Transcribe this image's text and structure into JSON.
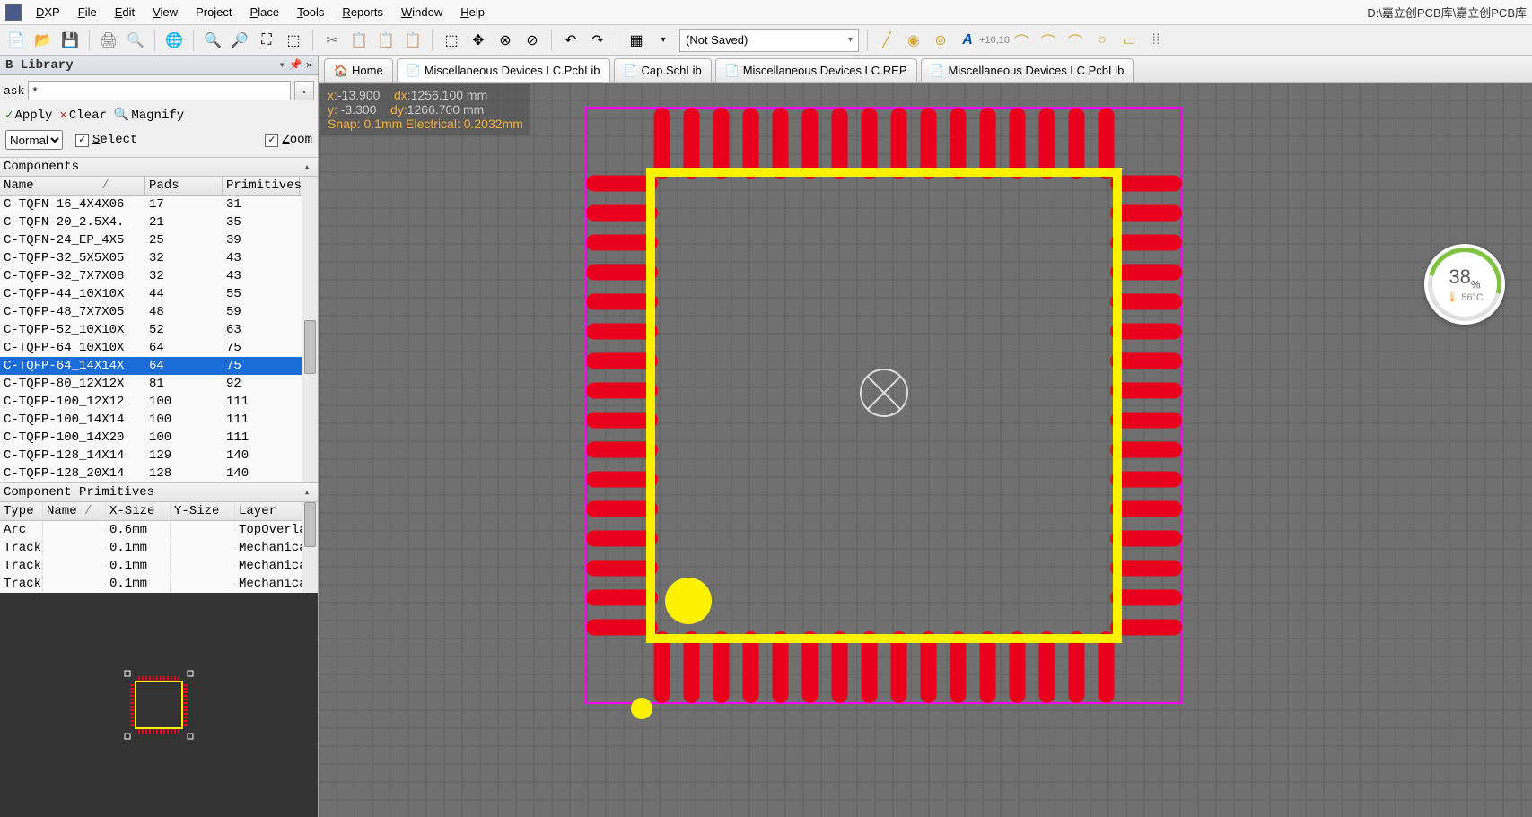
{
  "menu": {
    "items": [
      "DXP",
      "File",
      "Edit",
      "View",
      "Project",
      "Place",
      "Tools",
      "Reports",
      "Window",
      "Help"
    ],
    "keys": [
      "D",
      "F",
      "E",
      "V",
      "C",
      "P",
      "T",
      "R",
      "W",
      "H"
    ],
    "path": "D:\\嘉立创PCB库\\嘉立创PCB库"
  },
  "toolbar": {
    "combo": "(Not Saved)"
  },
  "panel": {
    "title": "B Library",
    "mask_label": "ask",
    "mask_value": "*",
    "apply": "Apply",
    "clear": "Clear",
    "magnify": "Magnify",
    "normal": "Normal",
    "select_label": "Select",
    "zoom_label": "Zoom"
  },
  "components": {
    "header": "Components",
    "cols": [
      "Name",
      "/",
      "Pads",
      "Primitives"
    ],
    "rows": [
      {
        "name": "C-TQFN-16_4X4X06",
        "pads": "17",
        "prim": "31"
      },
      {
        "name": "C-TQFN-20_2.5X4.",
        "pads": "21",
        "prim": "35"
      },
      {
        "name": "C-TQFN-24_EP_4X5",
        "pads": "25",
        "prim": "39"
      },
      {
        "name": "C-TQFP-32_5X5X05",
        "pads": "32",
        "prim": "43"
      },
      {
        "name": "C-TQFP-32_7X7X08",
        "pads": "32",
        "prim": "43"
      },
      {
        "name": "C-TQFP-44_10X10X",
        "pads": "44",
        "prim": "55"
      },
      {
        "name": "C-TQFP-48_7X7X05",
        "pads": "48",
        "prim": "59"
      },
      {
        "name": "C-TQFP-52_10X10X",
        "pads": "52",
        "prim": "63"
      },
      {
        "name": "C-TQFP-64_10X10X",
        "pads": "64",
        "prim": "75"
      },
      {
        "name": "C-TQFP-64_14X14X",
        "pads": "64",
        "prim": "75",
        "selected": true
      },
      {
        "name": "C-TQFP-80_12X12X",
        "pads": "81",
        "prim": "92"
      },
      {
        "name": "C-TQFP-100_12X12",
        "pads": "100",
        "prim": "111"
      },
      {
        "name": "C-TQFP-100_14X14",
        "pads": "100",
        "prim": "111"
      },
      {
        "name": "C-TQFP-100_14X20",
        "pads": "100",
        "prim": "111"
      },
      {
        "name": "C-TQFP-128_14X14",
        "pads": "129",
        "prim": "140"
      },
      {
        "name": "C-TQFP-128_20X14",
        "pads": "128",
        "prim": "140"
      }
    ]
  },
  "primitives": {
    "header": "Component Primitives",
    "cols": [
      "Type",
      "Name",
      "/",
      "X-Size",
      "Y-Size",
      "Layer"
    ],
    "rows": [
      {
        "type": "Arc",
        "name": "",
        "xs": "0.6mm",
        "ys": "",
        "layer": "TopOverla"
      },
      {
        "type": "Track",
        "name": "",
        "xs": "0.1mm",
        "ys": "",
        "layer": "Mechanica"
      },
      {
        "type": "Track",
        "name": "",
        "xs": "0.1mm",
        "ys": "",
        "layer": "Mechanica"
      },
      {
        "type": "Track",
        "name": "",
        "xs": "0.1mm",
        "ys": "",
        "layer": "Mechanica"
      }
    ]
  },
  "tabs": [
    {
      "label": "Home",
      "icon": "🏠"
    },
    {
      "label": "Miscellaneous Devices LC.PcbLib",
      "icon": "📄",
      "active": true
    },
    {
      "label": "Cap.SchLib",
      "icon": "📄"
    },
    {
      "label": "Miscellaneous Devices LC.REP",
      "icon": "📄"
    },
    {
      "label": "Miscellaneous Devices LC.PcbLib",
      "icon": "📄"
    }
  ],
  "hud": {
    "x_label": "x:",
    "x_val": "-13.900",
    "dx_label": "dx:",
    "dx_val": "1256.100 mm",
    "y_label": "y:",
    "y_val": "-3.300",
    "dy_label": "dy:",
    "dy_val": "1266.700 mm",
    "snap": "Snap: 0.1mm Electrical: 0.2032mm"
  },
  "gauge": {
    "pct": "38",
    "pct_unit": "%",
    "temp": "56°C"
  },
  "footprint": {
    "pads_per_side": 16,
    "body_size": 520,
    "pad_len": 80,
    "pad_w": 18,
    "pad_gap": 33,
    "colors": {
      "pad": "#e8001d",
      "outline": "#fff200",
      "court": "#ff00ff",
      "pin1": "#fff200",
      "grid_bg": "#707070",
      "grid_line": "#606060"
    }
  }
}
